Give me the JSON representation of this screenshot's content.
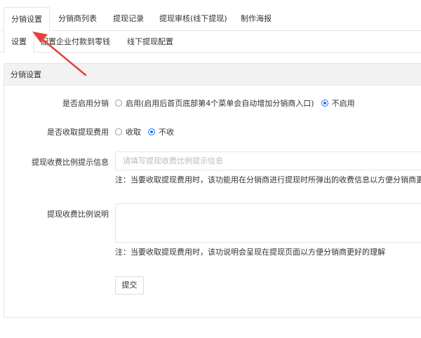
{
  "top_tabs": [
    {
      "label": "分销设置"
    },
    {
      "label": "分销商列表"
    },
    {
      "label": "提现记录"
    },
    {
      "label": "提现审核(线下提现)"
    },
    {
      "label": "制作海报"
    }
  ],
  "sub_tabs": [
    {
      "label": "设置"
    },
    {
      "label": "配置企业付款到零钱"
    },
    {
      "label": "线下提现配置"
    }
  ],
  "panel": {
    "title": "分销设置",
    "enable": {
      "label": "是否启用分销",
      "option_on": "启用(启用后首页底部第4个菜单会自动增加分销商入口)",
      "option_off": "不启用",
      "selected": "不启用"
    },
    "fee": {
      "label": "是否收取提现费用",
      "option_on": "收取",
      "option_off": "不收",
      "selected": "不收"
    },
    "ratio_tip": {
      "label": "提现收费比例提示信息",
      "placeholder": "请填写提现收费比例提示信息",
      "note": "注：当要收取提现费用时，该功能用在分销商进行提现时所弹出的收费信息以方便分销商更好的"
    },
    "ratio_desc": {
      "label": "提现收费比例说明",
      "note": "注：当要收取提现费用时，该功说明会呈现在提现页面以方便分销商更好的理解"
    },
    "submit_label": "提交"
  },
  "colors": {
    "accent": "#1e6fff",
    "annotation_arrow": "#e8413b"
  }
}
